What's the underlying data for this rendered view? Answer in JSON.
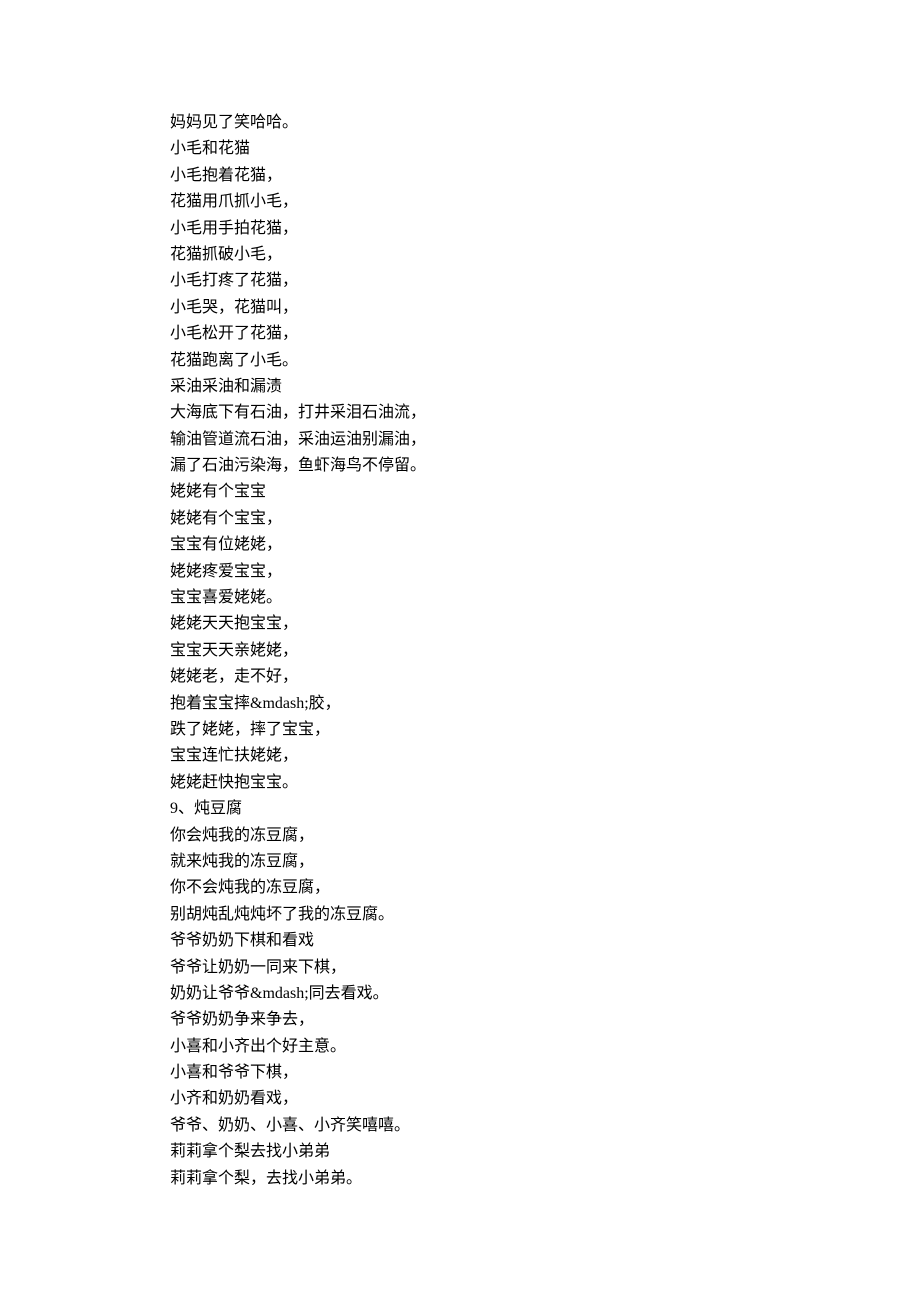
{
  "lines": [
    "妈妈见了笑哈哈。",
    "小毛和花猫",
    "小毛抱着花猫，",
    "花猫用爪抓小毛，",
    "小毛用手拍花猫，",
    "花猫抓破小毛，",
    "小毛打疼了花猫，",
    "小毛哭，花猫叫，",
    "小毛松开了花猫，",
    "花猫跑离了小毛。",
    "采油采油和漏渍",
    "大海底下有石油，打井采泪石油流，",
    "输油管道流石油，采油运油别漏油，",
    "漏了石油污染海，鱼虾海鸟不停留。",
    "姥姥有个宝宝",
    "姥姥有个宝宝，",
    "宝宝有位姥姥，",
    "姥姥疼爱宝宝，",
    "宝宝喜爱姥姥。",
    "姥姥天天抱宝宝，",
    "宝宝天天亲姥姥，",
    "姥姥老，走不好，",
    "抱着宝宝摔&mdash;胶，",
    "跌了姥姥，摔了宝宝，",
    "宝宝连忙扶姥姥，",
    "姥姥赶快抱宝宝。",
    "9、炖豆腐",
    "你会炖我的冻豆腐，",
    "就来炖我的冻豆腐，",
    "你不会炖我的冻豆腐，",
    "别胡炖乱炖炖坏了我的冻豆腐。",
    "爷爷奶奶下棋和看戏",
    "爷爷让奶奶一同来下棋，",
    "奶奶让爷爷&mdash;同去看戏。",
    "爷爷奶奶争来争去，",
    "小喜和小齐出个好主意。",
    "小喜和爷爷下棋，",
    "小齐和奶奶看戏，",
    "爷爷、奶奶、小喜、小齐笑嘻嘻。",
    "莉莉拿个梨去找小弟弟",
    "莉莉拿个梨，去找小弟弟。"
  ]
}
